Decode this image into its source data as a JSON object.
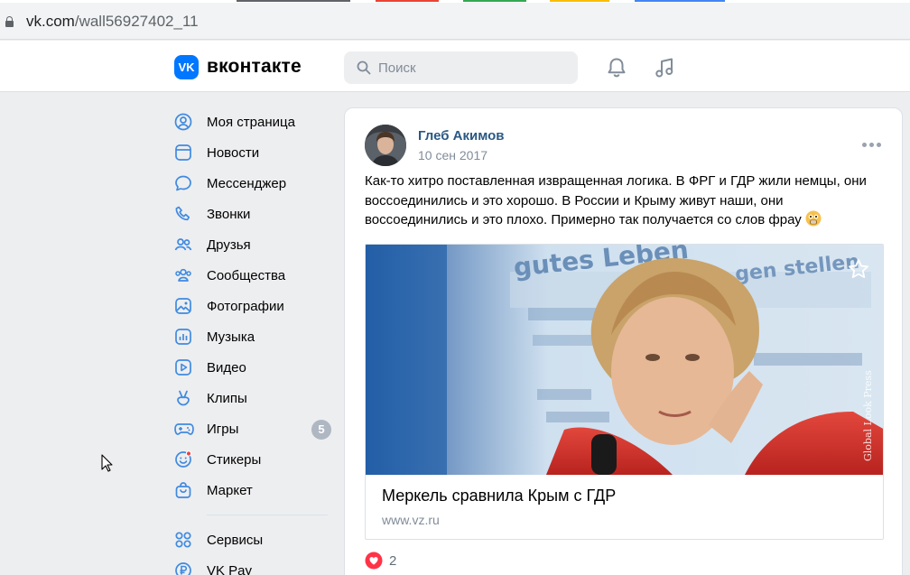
{
  "browser": {
    "url_host": "vk.com",
    "url_path": "/wall56927402_11",
    "tab_colors": [
      "#5f6368",
      "#ea4335",
      "#34a853",
      "#fbbc04",
      "#4285f4"
    ]
  },
  "header": {
    "logo_mark": "VK",
    "logo_text": "вконтакте",
    "search_placeholder": "Поиск",
    "icons": [
      "bell-icon",
      "music-icon"
    ]
  },
  "sidebar": {
    "items": [
      {
        "label": "Моя страница",
        "icon": "user-icon"
      },
      {
        "label": "Новости",
        "icon": "news-icon"
      },
      {
        "label": "Мессенджер",
        "icon": "message-icon"
      },
      {
        "label": "Звонки",
        "icon": "phone-icon"
      },
      {
        "label": "Друзья",
        "icon": "friends-icon"
      },
      {
        "label": "Сообщества",
        "icon": "groups-icon"
      },
      {
        "label": "Фотографии",
        "icon": "photo-icon"
      },
      {
        "label": "Музыка",
        "icon": "music-icon"
      },
      {
        "label": "Видео",
        "icon": "video-icon"
      },
      {
        "label": "Клипы",
        "icon": "clips-icon"
      },
      {
        "label": "Игры",
        "icon": "gamepad-icon",
        "badge": "5"
      },
      {
        "label": "Стикеры",
        "icon": "sticker-icon"
      },
      {
        "label": "Маркет",
        "icon": "bag-icon"
      }
    ],
    "services": [
      {
        "label": "Сервисы",
        "icon": "services-icon"
      },
      {
        "label": "VK Pay",
        "icon": "pay-icon"
      }
    ]
  },
  "post": {
    "author": "Глеб Акимов",
    "date": "10 сен 2017",
    "text": "Как-то хитро поставленная извращенная логика. В ФРГ и ГДР жили немцы, они воссоединились и это хорошо. В России и Крыму живут наши, они воссоединились и это плохо. Примерно так получается со слов фрау",
    "photo_text_top": "gutes Leben",
    "photo_text_mid": "gen stellen",
    "photo_watermark": "Global Look Press",
    "link_title": "Меркель сравнила Крым с ГДР",
    "link_domain": "www.vz.ru",
    "likes": "2"
  },
  "colors": {
    "accent": "#0077ff",
    "author": "#2a5885",
    "muted": "#818c99",
    "like": "#ff3347"
  }
}
